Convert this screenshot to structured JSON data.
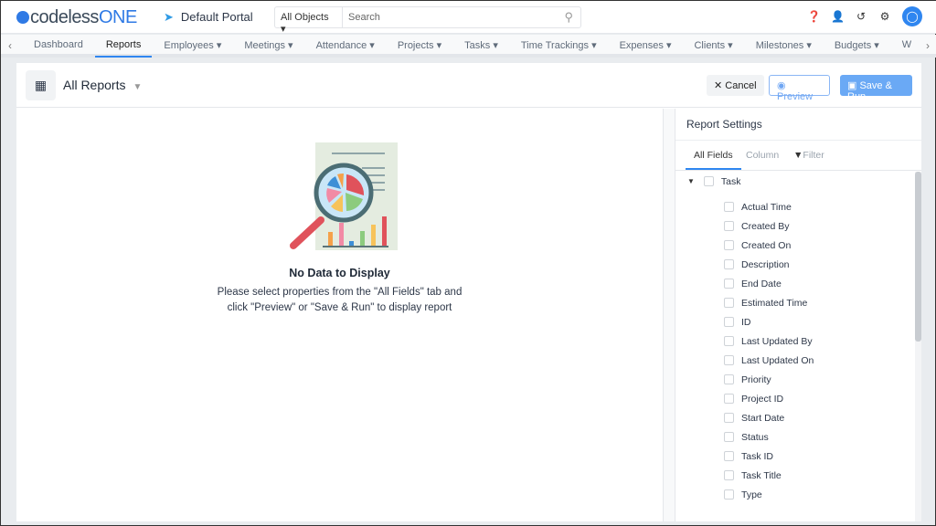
{
  "brand": {
    "name_prefix": "codeless",
    "name_suffix": "ONE",
    "color": "#2f7ae5"
  },
  "portal": {
    "label": "Default Portal"
  },
  "search": {
    "scope": "All Objects",
    "placeholder": "Search"
  },
  "header_icons": [
    "help-icon",
    "add-user-icon",
    "history-icon",
    "gear-icon",
    "user-avatar-icon"
  ],
  "nav": {
    "items": [
      "Dashboard",
      "Reports",
      "Employees",
      "Meetings",
      "Attendance",
      "Projects",
      "Tasks",
      "Time Trackings",
      "Expenses",
      "Clients",
      "Milestones",
      "Budgets",
      "W"
    ],
    "active": "Reports"
  },
  "report": {
    "title": "All Reports",
    "cancel": "Cancel",
    "preview": "Preview",
    "save_run": "Save & Run"
  },
  "empty": {
    "title": "No Data to Display",
    "line1": "Please select properties from the \"All Fields\" tab and",
    "line2": "click \"Preview\" or \"Save & Run\" to display report"
  },
  "settings": {
    "title": "Report Settings",
    "tabs": [
      "All Fields",
      "Column",
      "Filter"
    ],
    "group": "Task",
    "fields": [
      "Actual Time",
      "Created By",
      "Created On",
      "Description",
      "End Date",
      "Estimated Time",
      "ID",
      "Last Updated By",
      "Last Updated On",
      "Priority",
      "Project ID",
      "Start Date",
      "Status",
      "Task ID",
      "Task Title",
      "Type"
    ]
  }
}
